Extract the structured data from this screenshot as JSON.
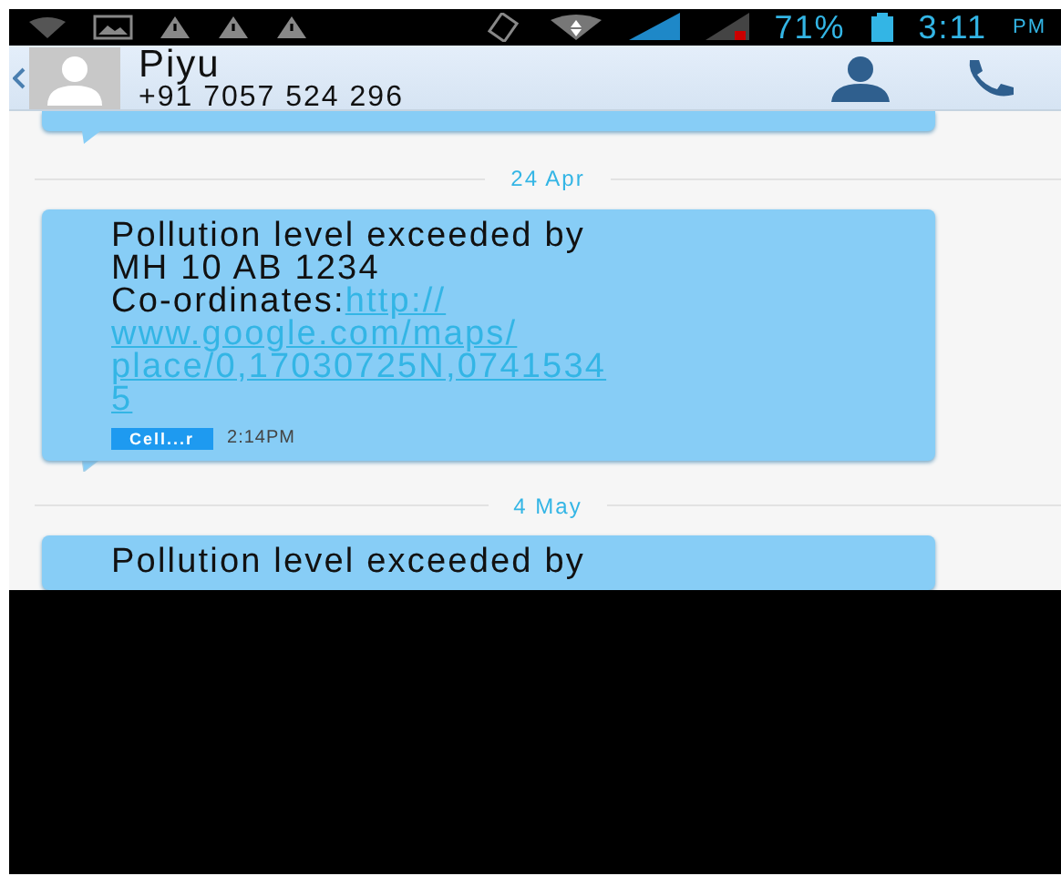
{
  "status_bar": {
    "battery": "71%",
    "time": "3:11",
    "period": "PM"
  },
  "contact": {
    "name": "Piyu",
    "number": "+91 7057 524 296"
  },
  "thread": [
    {
      "kind": "partial"
    },
    {
      "kind": "date",
      "label": "24 Apr"
    },
    {
      "kind": "message",
      "lines": [
        "Pollution level exceeded by",
        "MH 10 AB 1234",
        "Co-ordinates:"
      ],
      "link_lines": [
        "http://",
        "www.google.com/maps/",
        "place/0,17030725N,0741534",
        "5"
      ],
      "sim": "Cell...r",
      "time": "2:14PM"
    },
    {
      "kind": "date",
      "label": "4 May"
    },
    {
      "kind": "message",
      "lines": [
        "Pollution level exceeded by"
      ]
    }
  ]
}
